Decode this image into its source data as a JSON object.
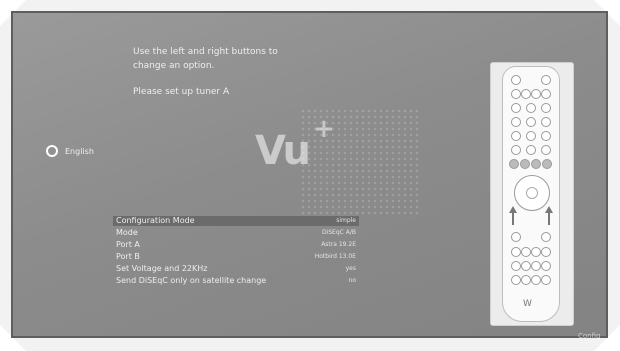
{
  "help": {
    "line1": "Use the left and right buttons to",
    "line2": "change an option.",
    "tuner_prompt": "Please set up tuner A"
  },
  "language": {
    "label": "English"
  },
  "logo": {
    "text": "Vu",
    "plus": "+"
  },
  "config": {
    "rows": [
      {
        "label": "Configuration Mode",
        "value": "simple",
        "selected": true
      },
      {
        "label": "Mode",
        "value": "DiSEqC A/B"
      },
      {
        "label": "Port A",
        "value": "Astra 19.2E"
      },
      {
        "label": "Port B",
        "value": "Hotbird 13.0E"
      },
      {
        "label": "Set Voltage and 22KHz",
        "value": "yes"
      },
      {
        "label": "Send DiSEqC only on satellite change",
        "value": "no"
      }
    ]
  },
  "remote": {
    "brand_mark": "W"
  },
  "watermark": "Config",
  "colors": {
    "selection": "#6b6b6b",
    "background": "#8c8c8c"
  }
}
